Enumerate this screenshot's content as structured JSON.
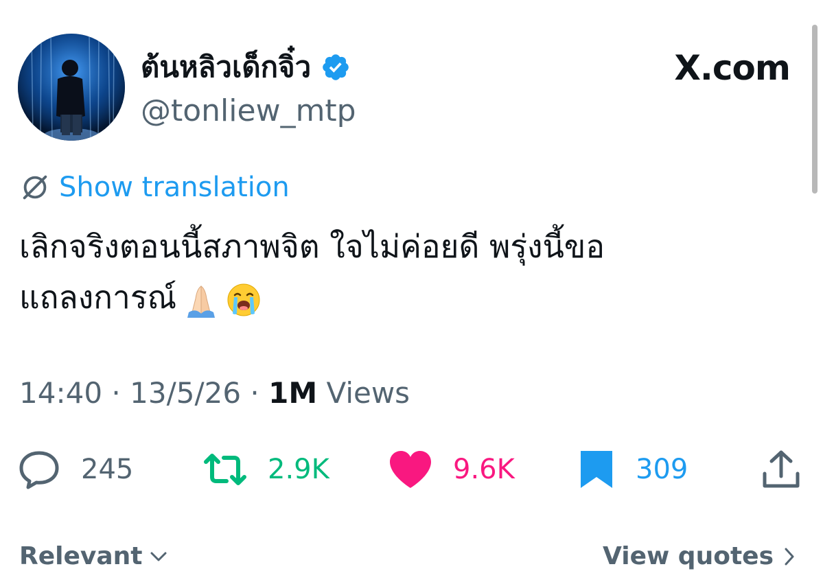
{
  "header": {
    "display_name": "ต้นหลิวเด็กจิ๋ว",
    "handle": "@tonliew_mtp",
    "verified": true,
    "watermark": "X.com"
  },
  "translate": {
    "label": "Show translation",
    "icon": "translate-icon"
  },
  "tweet": {
    "lines": [
      "เลิกจริงตอนนี้สภาพจิต ใจไม่ค่อยดี พรุ่งนี้ขอ",
      "แถลงการณ์"
    ],
    "emojis": [
      "folded-hands",
      "loudly-crying-face"
    ]
  },
  "meta": {
    "time": "14:40",
    "sep": "·",
    "date": "13/5/26",
    "views_count": "1M",
    "views_label": "Views"
  },
  "actions": {
    "replies": "245",
    "reposts": "2.9K",
    "likes": "9.6K",
    "bookmarks": "309"
  },
  "footer": {
    "sort_label": "Relevant",
    "quotes_label": "View quotes"
  },
  "colors": {
    "accent_blue": "#1d9bf0",
    "repost_green": "#00ba7c",
    "like_pink": "#f91880",
    "muted": "#536471",
    "text": "#0f1419"
  }
}
